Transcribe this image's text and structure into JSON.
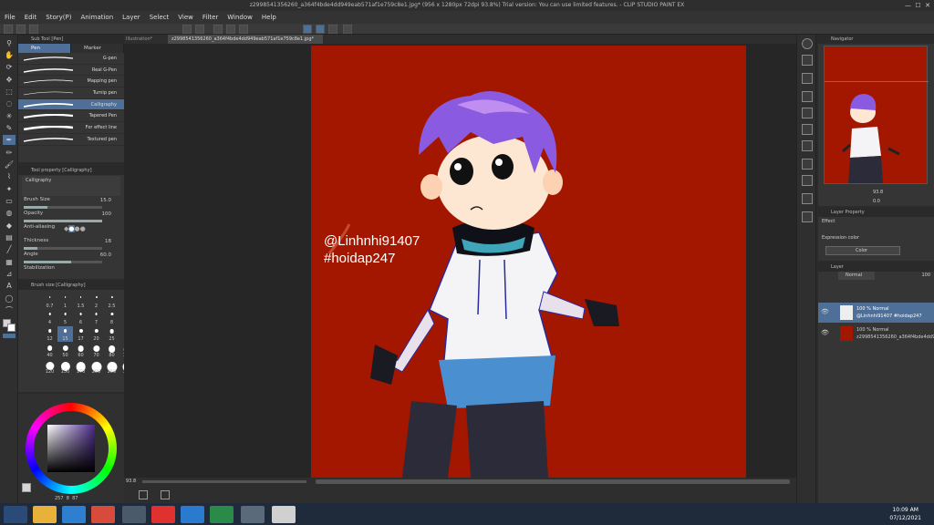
{
  "window": {
    "title": "z2998541356260_a364f4bde4dd949eab571af1e759c8e1.jpg* (956 x 1280px 72dpi 93.8%)  Trial version: You can use limited features. - CLIP STUDIO PAINT EX"
  },
  "menu": [
    "File",
    "Edit",
    "Story(P)",
    "Animation",
    "Layer",
    "Select",
    "View",
    "Filter",
    "Window",
    "Help"
  ],
  "sub_tool": {
    "header": "Sub Tool [Pen]",
    "tabs": [
      "Pen",
      "Marker"
    ],
    "brushes": [
      {
        "label": "G-pen"
      },
      {
        "label": "Real G-Pen"
      },
      {
        "label": "Mapping pen"
      },
      {
        "label": "Turnip pen"
      },
      {
        "label": "Calligraphy"
      },
      {
        "label": "Tapered Pen"
      },
      {
        "label": "For effect line"
      },
      {
        "label": "Textured pen"
      }
    ],
    "selected": "Calligraphy"
  },
  "tool_property": {
    "header": "Tool property [Calligraphy]",
    "preset": "Calligraphy",
    "brush_size": {
      "label": "Brush Size",
      "value": "15.0",
      "fraction": 0.3
    },
    "opacity": {
      "label": "Opacity",
      "value": "100",
      "fraction": 1.0
    },
    "anti_aliasing": {
      "label": "Anti-aliasing"
    },
    "thickness": {
      "label": "Thickness",
      "value": "18",
      "fraction": 0.18
    },
    "angle": {
      "label": "Angle",
      "value": "60.0",
      "fraction": 0.6
    },
    "stabilization": {
      "label": "Stabilization"
    }
  },
  "brush_size_panel": {
    "header": "Brush size [Calligraphy]",
    "sizes": [
      "0.7",
      "1",
      "1.5",
      "2",
      "2.5",
      "3",
      "4",
      "5",
      "6",
      "7",
      "8",
      "10",
      "12",
      "15",
      "17",
      "20",
      "25",
      "30",
      "40",
      "50",
      "60",
      "70",
      "80",
      "100",
      "120",
      "150",
      "170",
      "200",
      "250",
      "300"
    ],
    "selected": "15"
  },
  "color": {
    "primary": "#d6d6d6",
    "counter": "257",
    "v1": "8",
    "v2": "87"
  },
  "documents": {
    "tab1": "Illustration*",
    "tab2": "z2998541356260_a364f4bde4dd949eab571af1e759c8e1.jpg*"
  },
  "artwork": {
    "background": "#a31700",
    "watermark_line1": "@Linhnhi91407",
    "watermark_line2": "#hoidap247"
  },
  "canvas_status": {
    "zoom": "93.8"
  },
  "navigator": {
    "title": "Navigator",
    "zoom": "93.8",
    "angle": "0.0"
  },
  "layer_property": {
    "title": "Layer Property",
    "effect_label": "Effect",
    "expression_label": "Expression color",
    "expression_value": "Color"
  },
  "layers_panel": {
    "tab": "Layer",
    "blend": "Normal",
    "opacity": "100",
    "layers": [
      {
        "line1": "100 % Normal",
        "line2": "@Linhnhi91407 #hoidap247"
      },
      {
        "line1": "100 % Normal",
        "line2": "z2998541356260_a364f4bde4dd949"
      }
    ]
  },
  "taskbar": {
    "time": "10:09 AM",
    "date": "07/12/2021"
  }
}
